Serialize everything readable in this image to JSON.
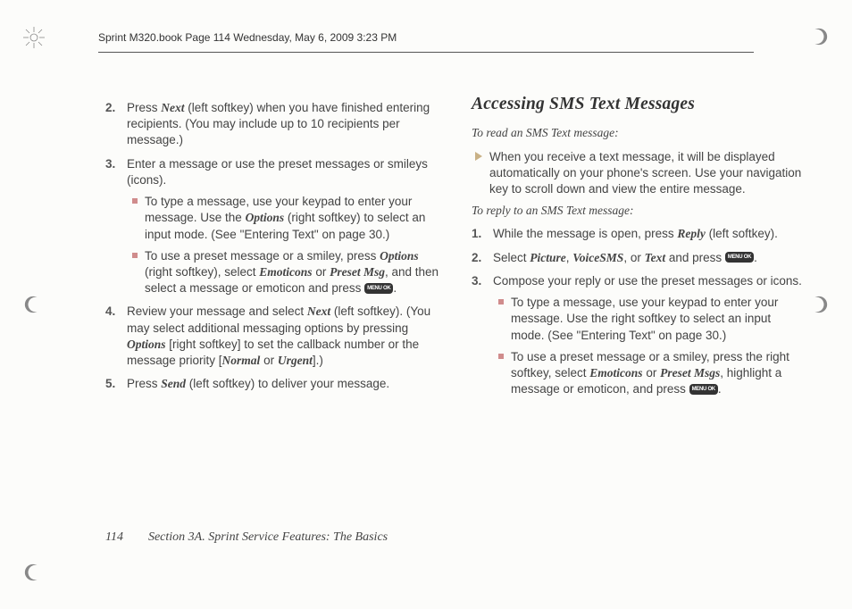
{
  "header": "Sprint M320.book  Page 114  Wednesday, May 6, 2009  3:23 PM",
  "keycap_label": "MENU OK",
  "left": {
    "steps": [
      {
        "prefix": "Press ",
        "em1": "Next",
        "rest": " (left softkey) when you have finished entering recipients. (You may include up to 10 recipients per message.)"
      },
      {
        "text": "Enter a message or use the preset messages or smileys (icons).",
        "bullets": [
          {
            "t1": "To type a message, use your keypad to enter your message. Use the ",
            "em1": "Options",
            "t2": " (right softkey) to select an input mode. (See \"Entering Text\" on page 30.)"
          },
          {
            "t1": "To use a preset message or a smiley, press ",
            "em1": "Options",
            "t2": " (right softkey), select ",
            "em2": "Emoticons",
            "t3": " or ",
            "em3": "Preset Msg",
            "t4": ", and then select a message or emoticon and press ",
            "keycap": true,
            "t5": "."
          }
        ]
      },
      {
        "t1": "Review your message and select ",
        "em1": "Next",
        "t2": " (left softkey). (You may select additional messaging options by pressing ",
        "em2": "Options",
        "t3": " [right softkey] to set the callback number or the message priority [",
        "em3": "Normal",
        "t4": " or ",
        "em4": "Urgent",
        "t5": "].)"
      },
      {
        "t1": "Press ",
        "em1": "Send",
        "t2": " (left softkey) to deliver your message."
      }
    ]
  },
  "right": {
    "title": "Accessing SMS Text Messages",
    "sub1": "To read an SMS Text message:",
    "tri1": "When you receive a text message, it will be displayed automatically on your phone's screen. Use your navigation key to scroll down and view the entire message.",
    "sub2": "To reply to an SMS Text message:",
    "steps": [
      {
        "t1": "While the message is open, press ",
        "em1": "Reply",
        "t2": " (left softkey)."
      },
      {
        "t1": "Select ",
        "em1": "Picture",
        "t2": ", ",
        "em2": "VoiceSMS",
        "t3": ", or ",
        "em3": "Text",
        "t4": " and press ",
        "keycap": true,
        "t5": "."
      },
      {
        "text": "Compose your reply or use the preset messages or icons.",
        "bullets": [
          {
            "t1": "To type a message, use your keypad to enter your message. Use the right softkey to select an input mode. (See \"Entering Text\" on page 30.)"
          },
          {
            "t1": "To use a preset message or a smiley, press the right softkey, select ",
            "em1": "Emoticons",
            "t2": " or ",
            "em2": "Preset Msgs",
            "t3": ", highlight a message or emoticon, and press ",
            "keycap": true,
            "t4": "."
          }
        ]
      }
    ]
  },
  "footer": {
    "page": "114",
    "section": "Section 3A. Sprint Service Features: The Basics"
  }
}
